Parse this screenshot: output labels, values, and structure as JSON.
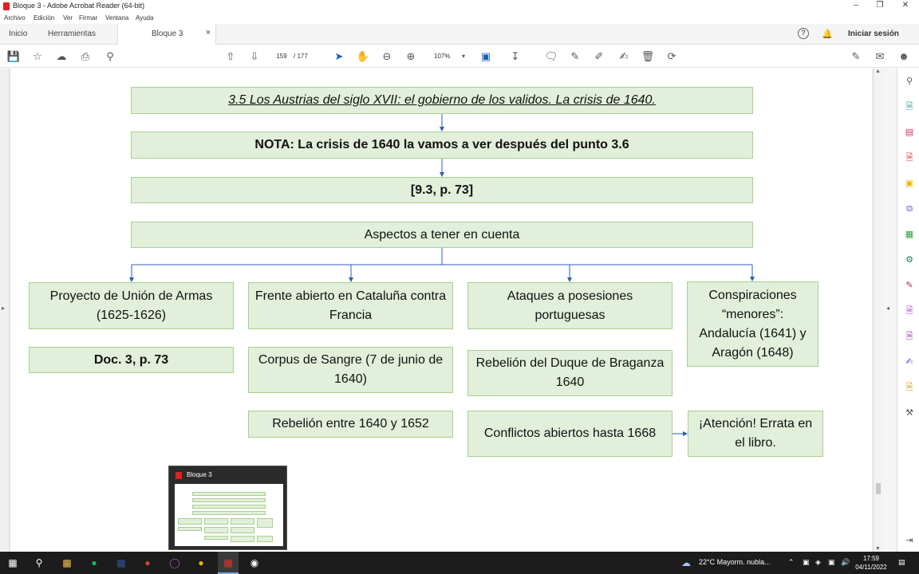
{
  "window": {
    "title": "Bloque 3 - Adobe Acrobat Reader (64-bit)",
    "minimize": "–",
    "maximize": "❐",
    "close": "✕"
  },
  "menu": [
    "Archivo",
    "Edición",
    "Ver",
    "Firmar",
    "Ventana",
    "Ayuda"
  ],
  "tabs": {
    "home": "Inicio",
    "tools": "Herramientas",
    "document": "Bloque 3",
    "close": "×",
    "help": "?",
    "signin": "Iniciar sesión"
  },
  "toolbar": {
    "page_current": "159",
    "page_total": "/ 177",
    "zoom": "107%"
  },
  "diagram": {
    "title": "3.5 Los Austrias del siglo XVII: el gobierno de los validos. La crisis de 1640.",
    "note": "NOTA: La crisis de 1640 la vamos a ver después del punto 3.6",
    "ref": "[9.3, p. 73]",
    "aspects": "Aspectos a tener en cuenta",
    "col1_head": "Proyecto de Unión de Armas (1625-1626)",
    "col1_doc": "Doc. 3, p. 73",
    "col2_head": "Frente abierto en Cataluña contra Francia",
    "col2_item1": "Corpus de Sangre (7 de junio de 1640)",
    "col2_item2": "Rebelión entre 1640 y 1652",
    "col3_head": "Ataques a posesiones portuguesas",
    "col3_item1": "Rebelión del Duque de Braganza 1640",
    "col3_item2": "Conflictos abiertos hasta 1668",
    "col4_head": "Conspiraciones “menores”: Andalucía (1641) y Aragón (1648)",
    "col4_item": "¡Atención! Errata en el libro."
  },
  "thumbnail": {
    "label": "Bloque 3"
  },
  "taskbar": {
    "weather": "22°C  Mayorm. nubla...",
    "time": "17:59",
    "date": "04/11/2022"
  },
  "colors": {
    "box_fill": "#e2efda",
    "box_border": "#a9d08e",
    "connector": "#2e5fb0",
    "taskbar": "#1c1c1c"
  }
}
